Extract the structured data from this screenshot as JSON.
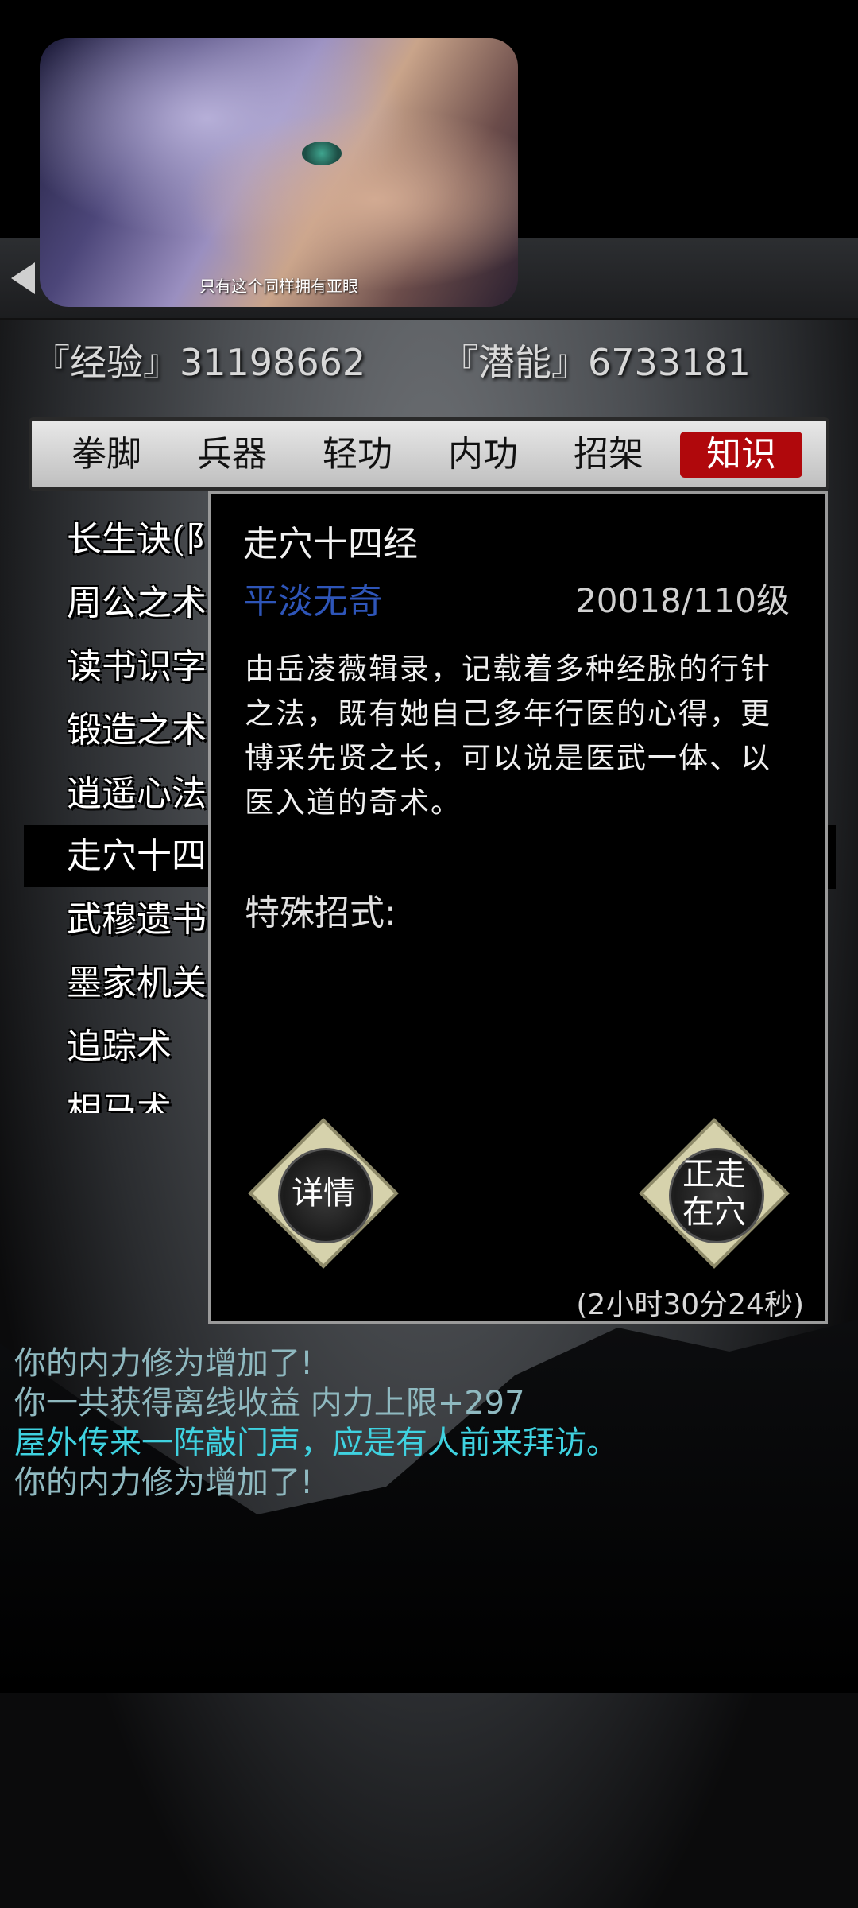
{
  "video": {
    "subtitle": "只有这个同样拥有亚眼"
  },
  "stats": {
    "exp": "『经验』31198662",
    "potential": "『潜能』6733181"
  },
  "tabs": [
    {
      "label": "拳脚"
    },
    {
      "label": "兵器"
    },
    {
      "label": "轻功"
    },
    {
      "label": "内功"
    },
    {
      "label": "招架"
    },
    {
      "label": "知识",
      "active": true
    }
  ],
  "list": [
    {
      "label": "长生诀(阝"
    },
    {
      "label": "周公之术"
    },
    {
      "label": "读书识字"
    },
    {
      "label": "锻造之术"
    },
    {
      "label": "逍遥心法"
    },
    {
      "label": "走穴十四",
      "selected": true
    },
    {
      "label": "武穆遗书"
    },
    {
      "label": "墨家机关"
    },
    {
      "label": "追踪术"
    },
    {
      "label": "相马术"
    }
  ],
  "popup": {
    "title": "走穴十四经",
    "quality": "平淡无奇",
    "level": "20018/110级",
    "description": "由岳凌薇辑录，记载着多种经脉的行针之法，既有她自己多年行医的心得，更博采先贤之长，可以说是医武一体、以医入道的奇术。",
    "special_label": "特殊招式:",
    "detail_button": "详情",
    "walk_button_line1": "正走",
    "walk_button_line2": "在穴",
    "time": "(2小时30分24秒)"
  },
  "log": [
    {
      "text": "你的内力修为增加了!"
    },
    {
      "text": "你一共获得离线收益 内力上限+297"
    },
    {
      "text": "屋外传来一阵敲门声，应是有人前来拜访。",
      "highlight": true
    },
    {
      "text": "你的内力修为增加了!"
    }
  ],
  "colors": {
    "active_tab": "#b0080c",
    "quality": "#2e55b8",
    "log": "#8fb9c0",
    "log_highlight": "#3fd2e0"
  }
}
